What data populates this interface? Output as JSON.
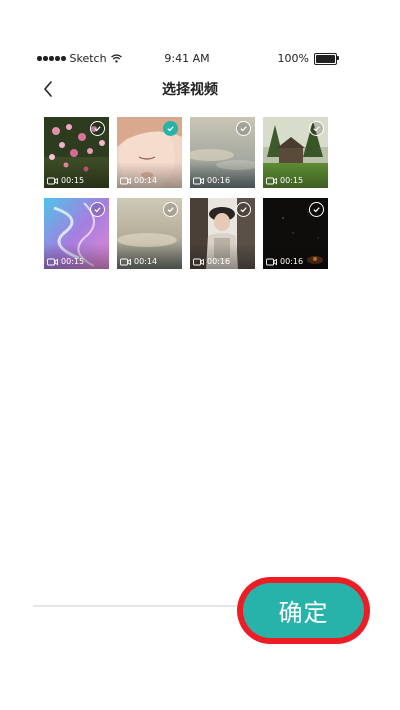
{
  "status_bar": {
    "carrier": "Sketch",
    "time": "9:41 AM",
    "battery": "100%"
  },
  "nav": {
    "title": "选择视频"
  },
  "videos": [
    {
      "duration": "00:15",
      "selected": false
    },
    {
      "duration": "00:14",
      "selected": true
    },
    {
      "duration": "00:16",
      "selected": false
    },
    {
      "duration": "00:15",
      "selected": false
    },
    {
      "duration": "00:15",
      "selected": false
    },
    {
      "duration": "00:14",
      "selected": false
    },
    {
      "duration": "00:16",
      "selected": false
    },
    {
      "duration": "00:16",
      "selected": false
    }
  ],
  "confirm_button": {
    "label": "确定"
  },
  "colors": {
    "accent": "#27b3aa",
    "highlight_ring": "#ee1c25"
  }
}
